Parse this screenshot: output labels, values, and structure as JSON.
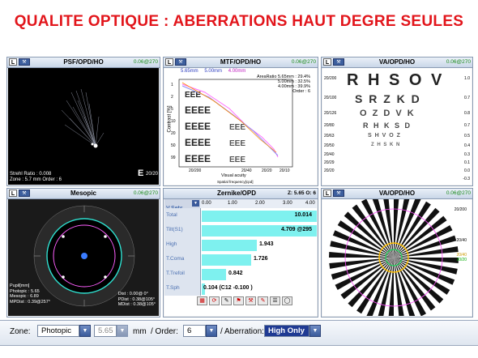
{
  "slide_title": "QUALITE OPTIQUE : ABERRATIONS HAUT DEGRE SEULES",
  "panels": {
    "psf": {
      "tag": "L",
      "title": "PSF/OPD/HO",
      "value": "0.06@270",
      "strehl": "Strehl Ratio :  0.008",
      "zone": "Zone : 5.7 mm  Order :  6",
      "e_label": "E",
      "e_fraction": "20/20"
    },
    "mtf": {
      "tag": "L",
      "title": "MTF/OPD/HO",
      "value": "0.06@270",
      "legend": [
        "5.65mm",
        "5.00mm",
        "4.00mm"
      ],
      "area_ratio": [
        "AreaRatio 5.65mm : 29.4%",
        "5.00mm : 32.5%",
        "4.00mm : 39.9%",
        "Order : 6"
      ],
      "ylabel": "Contrast [%]",
      "xlabel": "Visual acuity",
      "xlabel2": "Spatial frequency[cpd]",
      "xticks": [
        "20/200",
        "20/40",
        "20/20",
        "20/10"
      ],
      "yticks": [
        "1",
        "2",
        "5",
        "10",
        "20",
        "50",
        "99"
      ]
    },
    "va": {
      "tag": "L",
      "title": "VA/OPD/HO",
      "value": "0.06@270",
      "rows": [
        {
          "letters": "R H S O V",
          "left": "20/200",
          "right": "1.0"
        },
        {
          "letters": "S R Z K D",
          "left": "20/100",
          "right": "0.7"
        },
        {
          "letters": "O Z D V K",
          "left": "20/126",
          "right": "0.8"
        },
        {
          "letters": "R H K S D",
          "left": "20/80",
          "right": "0.7"
        },
        {
          "letters": "S H V O Z",
          "left": "20/63",
          "right": "0.5"
        },
        {
          "letters": "Z H S K N",
          "left": "20/50",
          "right": "0.4"
        },
        {
          "letters": "",
          "left": "20/40",
          "right": "0.3"
        },
        {
          "letters": "",
          "left": "20/29",
          "right": "0.1"
        },
        {
          "letters": "",
          "left": "20/20",
          "right": "0.0"
        },
        {
          "letters": "",
          "left": "",
          "right": "-0.3"
        }
      ]
    },
    "mesopic": {
      "tag": "L",
      "title": "Mesopic",
      "value": "0.06@270",
      "pupil": [
        "Pupil[mm]",
        "Photopic : 5.65",
        "Mesopic : 6.89",
        "MPDist : 0.39@257°"
      ],
      "dist": [
        "Dist : 0.00@  0°",
        "PDist : 0.38@105°",
        "MDist : 0.38@105°"
      ]
    },
    "zernike": {
      "title": "Zernike/OPD",
      "zinfo": "Z: 5.65 O: 6",
      "sets_label": "V.Sets",
      "scale": [
        "0.00",
        "1.00",
        "2.00",
        "3.00",
        "4.00"
      ],
      "rows": [
        {
          "label": "Total",
          "value": "10.014",
          "bar": 1.0
        },
        {
          "label": "Tilt(S1)",
          "value": "4.709 @295",
          "bar": 1.0
        },
        {
          "label": "High",
          "value": "1.943",
          "bar": 0.48
        },
        {
          "label": "T.Coma",
          "value": "1.726",
          "bar": 0.43
        },
        {
          "label": "T.Trefoil",
          "value": "0.842",
          "bar": 0.21
        },
        {
          "label": "T.Sph",
          "value": "0.104 (C12 -0.100 )",
          "bar": 0.03
        }
      ]
    },
    "va2": {
      "tag": "L",
      "title": "VA/OPD/HO",
      "value": "0.06@270",
      "labels": [
        "20/200",
        "20/40",
        "20/40",
        "20/20"
      ]
    }
  },
  "bottom": {
    "zone_label": "Zone:",
    "zone_value": "Photopic",
    "size_value": "5.65",
    "mm": "mm",
    "order_label": "/ Order:",
    "order_value": "6",
    "aberration_label": "/ Aberration:",
    "aberration_value": "High Only"
  },
  "colors": {
    "title": "#e2151b",
    "accent": "#1f3a93",
    "cyan": "#7ef1ef",
    "green_value": "#1a8a1a"
  }
}
